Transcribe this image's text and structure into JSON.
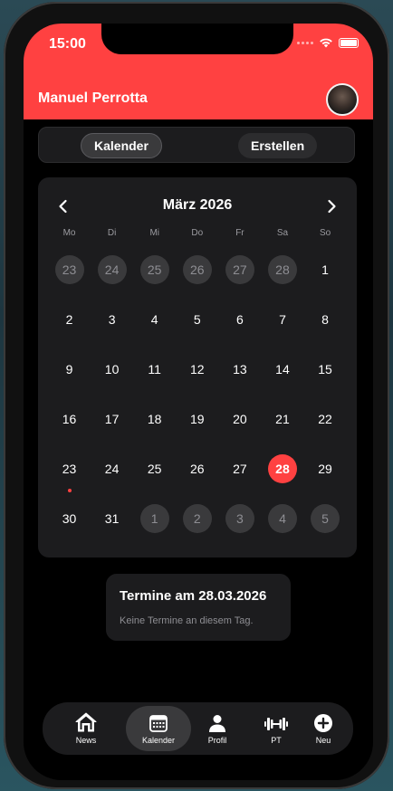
{
  "status_bar": {
    "time": "15:00"
  },
  "header": {
    "user_name": "Manuel Perrotta"
  },
  "segment": {
    "calendar_label": "Kalender",
    "create_label": "Erstellen"
  },
  "calendar": {
    "month_title": "März 2026",
    "prev_label": "‹",
    "next_label": "›",
    "weekdays": [
      "Mo",
      "Di",
      "Mi",
      "Do",
      "Fr",
      "Sa",
      "So"
    ],
    "weeks": [
      [
        "23",
        "24",
        "25",
        "26",
        "27",
        "28",
        "1"
      ],
      [
        "2",
        "3",
        "4",
        "5",
        "6",
        "7",
        "8"
      ],
      [
        "9",
        "10",
        "11",
        "12",
        "13",
        "14",
        "15"
      ],
      [
        "16",
        "17",
        "18",
        "19",
        "20",
        "21",
        "22"
      ],
      [
        "23",
        "24",
        "25",
        "26",
        "27",
        "28",
        "29"
      ],
      [
        "30",
        "31",
        "1",
        "2",
        "3",
        "4",
        "5"
      ]
    ],
    "selected_day": "28",
    "event_marker_day": "23"
  },
  "appointments": {
    "title": "Termine am 28.03.2026",
    "empty_text": "Keine Termine an diesem Tag."
  },
  "tabbar": {
    "items": [
      {
        "label": "News",
        "icon": "home-icon"
      },
      {
        "label": "Kalender",
        "icon": "calendar-icon"
      },
      {
        "label": "Profil",
        "icon": "person-icon"
      },
      {
        "label": "PT",
        "icon": "dumbbell-icon"
      },
      {
        "label": "Neu",
        "icon": "plus-circle-icon"
      }
    ]
  },
  "colors": {
    "accent": "#ff4141",
    "surface": "#1c1c1e",
    "background": "#000000"
  }
}
